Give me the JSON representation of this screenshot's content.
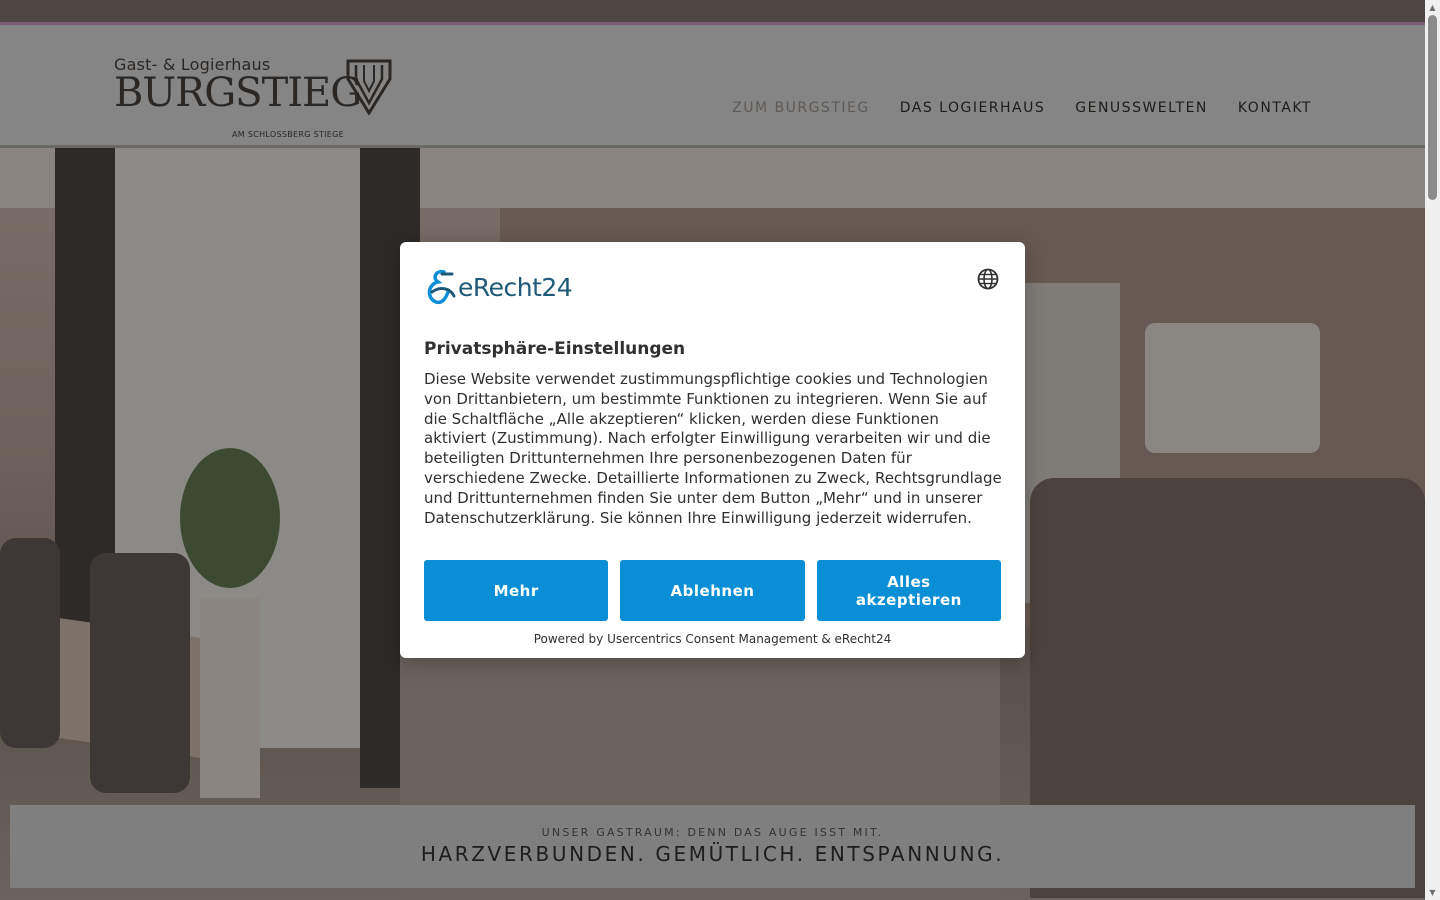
{
  "header": {
    "logo": {
      "subtitle": "Gast- & Logierhaus",
      "name": "BURGSTIEG",
      "tagline": "AM SCHLOSSBERG STIEGE"
    },
    "nav": [
      {
        "label": "ZUM BURGSTIEG",
        "active": true
      },
      {
        "label": "DAS LOGIERHAUS",
        "active": false
      },
      {
        "label": "GENUSSWELTEN",
        "active": false
      },
      {
        "label": "KONTAKT",
        "active": false
      }
    ]
  },
  "hero": {
    "caption_sub": "UNSER GASTRAUM: DENN DAS AUGE ISST MIT.",
    "caption_title": "HARZVERBUNDEN. GEMÜTLICH. ENTSPANNUNG."
  },
  "consent": {
    "brand": "eRecht24",
    "language_icon": "globe-icon",
    "title": "Privatsphäre-Einstellungen",
    "body": "Diese Website verwendet zustimmungspflichtige cookies und Technologien von Drittanbietern, um bestimmte Funktionen zu integrieren. Wenn Sie auf die Schaltfläche „Alle akzeptieren“ klicken, werden diese Funktionen aktiviert (Zustimmung). Nach erfolgter Einwilligung verarbeiten wir und die beteiligten Drittunternehmen Ihre personenbezogenen Daten für verschiedene Zwecke. Detaillierte Informationen zu Zweck, Rechtsgrundlage und Drittunternehmen finden Sie unter dem Button „Mehr“ und in unserer Datenschutzerklärung. Sie können Ihre Einwilligung jederzeit widerrufen.",
    "buttons": {
      "more": "Mehr",
      "decline": "Ablehnen",
      "accept_all": "Alles akzeptieren"
    },
    "powered_by": "Powered by Usercentrics Consent Management & eRecht24"
  },
  "colors": {
    "button_blue": "#0a8fd6",
    "brand_teal": "#1d5a7a",
    "nav_accent": "#7e5d76"
  }
}
